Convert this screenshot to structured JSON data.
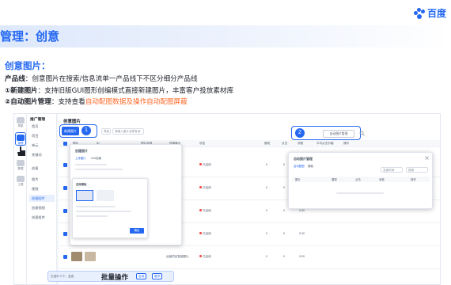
{
  "logo": {
    "text": "百度",
    "icon": "baidu-paw-icon"
  },
  "slide": {
    "title": "管理：创意",
    "section_title": "创意图片：",
    "bullets": [
      {
        "label": "产品线",
        "text": "：创意图片在搜索/信息流单一产品线下不区分细分产品线",
        "highlight": ""
      },
      {
        "label": "①新建图片",
        "text": "：支持旧版GUI图形创编模式直接新建图片，丰富客户投放素材库",
        "highlight": ""
      },
      {
        "label": "②自动图片管理",
        "text": "：支持查看",
        "highlight": "自动配图数据及操作自动配图屏蔽"
      }
    ]
  },
  "app": {
    "rail": [
      "导航",
      "管理",
      "数据",
      "工具"
    ],
    "menu_title": "推广管理",
    "menu_items": [
      "首页",
      "项目",
      "单元",
      "关键词",
      "创意",
      "图片",
      "视频",
      "创意图片",
      "创意视频",
      "创意组件"
    ],
    "selected_menu": "创意图片",
    "page_title": "创意图片",
    "new_button": "新建图片",
    "filter_placeholder": "请输入图片名称查询",
    "filter_label": "筛选",
    "auto_button": "自动图片管理",
    "callout_1": "1",
    "callout_2": "2",
    "columns": [
      "图片",
      "ID",
      "图片名称",
      "所属单元",
      "状态",
      "展现",
      "点击",
      "消费",
      "平均点击价格",
      "操作"
    ],
    "rows": [
      {
        "name": "",
        "status": "已启用",
        "shows": "0",
        "clicks": "0",
        "cost": "0.00"
      },
      {
        "name": "",
        "status": "已启用",
        "shows": "0",
        "clicks": "0",
        "cost": "0.00"
      },
      {
        "name": "",
        "status": "已启用",
        "shows": "0",
        "clicks": "0",
        "cost": "0.00"
      },
      {
        "name": "",
        "status": "已启用",
        "shows": "0",
        "clicks": "0",
        "cost": "0.00"
      },
      {
        "name": "运营项目智能图片",
        "status": "已启用",
        "shows": "0",
        "clicks": "0",
        "cost": "0.00"
      }
    ],
    "popup1": {
      "title": "创建图片",
      "tabs": [
        "上传图片",
        "GUI创编"
      ],
      "inner_title": "选择模板",
      "inner_confirm": "确定"
    },
    "popup2": {
      "title": "自动图片管理",
      "tabs": [
        "自动配图",
        "屏蔽"
      ],
      "filter": "全部时间",
      "search_placeholder": "搜索",
      "columns": [
        "图片",
        "展现",
        "点击",
        "消费",
        "操作"
      ]
    },
    "batch": {
      "selected_text": "已选中 4 个，全选",
      "label": "批量操作",
      "btn_a": "启用",
      "btn_b": "暂停"
    }
  },
  "colors": {
    "accent": "#2468f2",
    "highlight": "#ff6a2a",
    "status_red": "#f53f3f"
  }
}
